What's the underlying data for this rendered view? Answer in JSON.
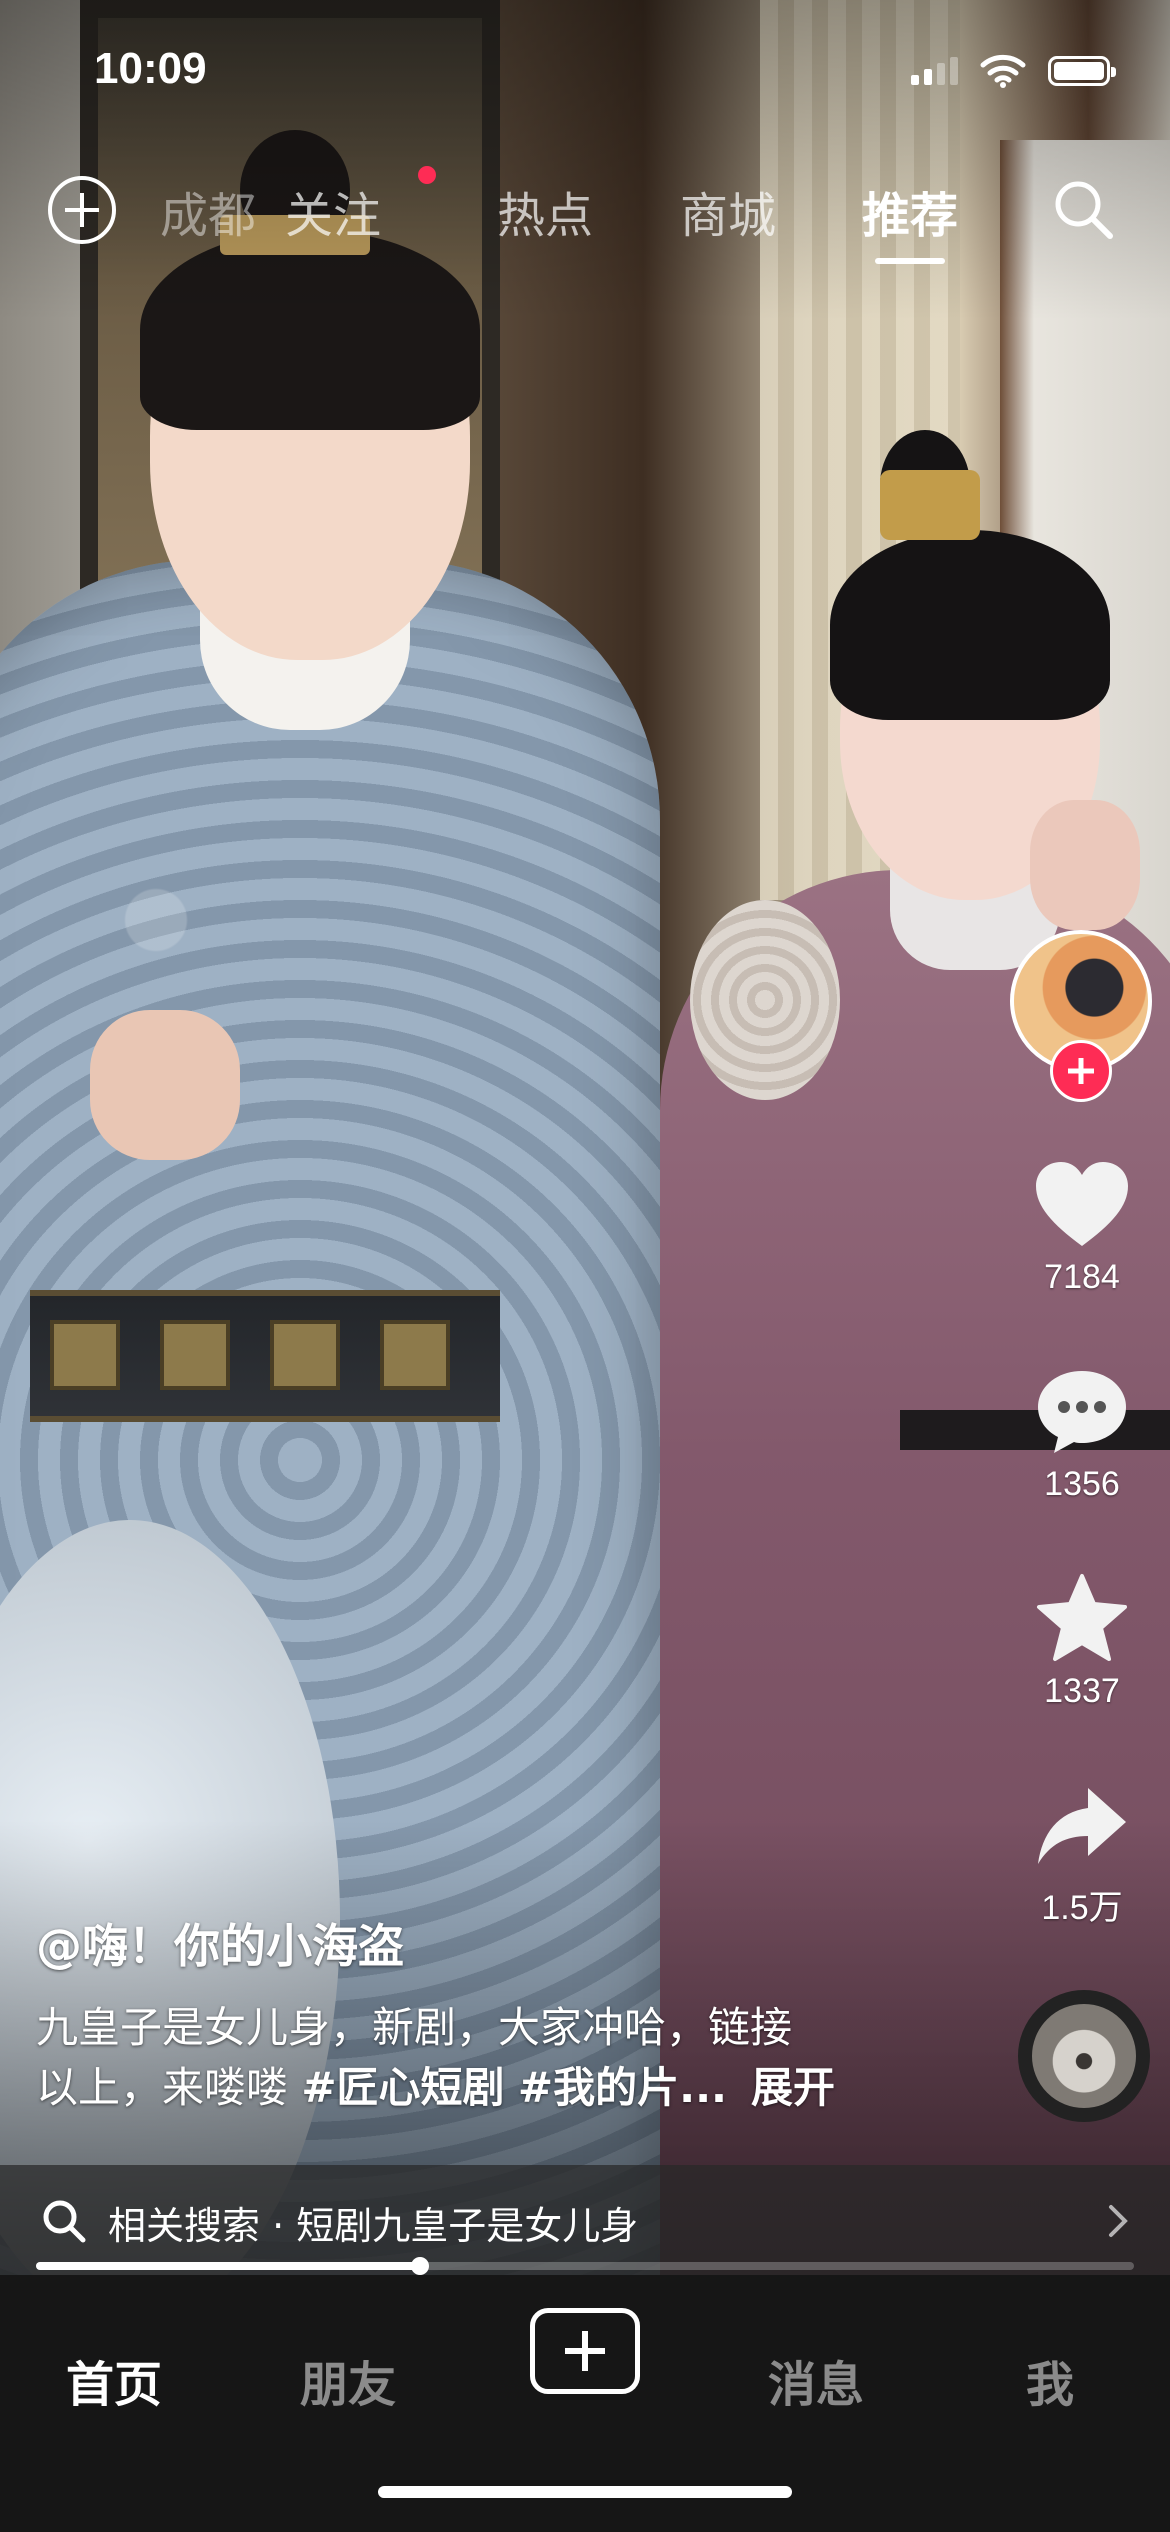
{
  "status_bar": {
    "time": "10:09"
  },
  "top_nav": {
    "tabs": [
      {
        "label": "成都",
        "state": "faded"
      },
      {
        "label": "关注",
        "state": "normal",
        "has_dot": true
      },
      {
        "label": "热点",
        "state": "normal"
      },
      {
        "label": "商城",
        "state": "normal"
      },
      {
        "label": "推荐",
        "state": "active"
      }
    ]
  },
  "actions": {
    "like_count": "7184",
    "comment_count": "1356",
    "favorite_count": "1337",
    "share_count": "1.5万"
  },
  "video": {
    "author": "@嗨！你的小海盗",
    "desc_line1": "九皇子是女儿身，新剧，大家冲哈，链接",
    "desc_line2_prefix": "以上，来喽喽 ",
    "tag1": "#匠心短剧",
    "tag2": "#我的片...",
    "expand_label": "展开",
    "progress_fraction": 0.35
  },
  "related_search": {
    "text": "相关搜索 · 短剧九皇子是女儿身"
  },
  "bottom_nav": {
    "home": "首页",
    "friends": "朋友",
    "messages": "消息",
    "me": "我"
  },
  "colors": {
    "accent_red": "#fe2c55",
    "bottom_bar_bg": "#161616"
  }
}
